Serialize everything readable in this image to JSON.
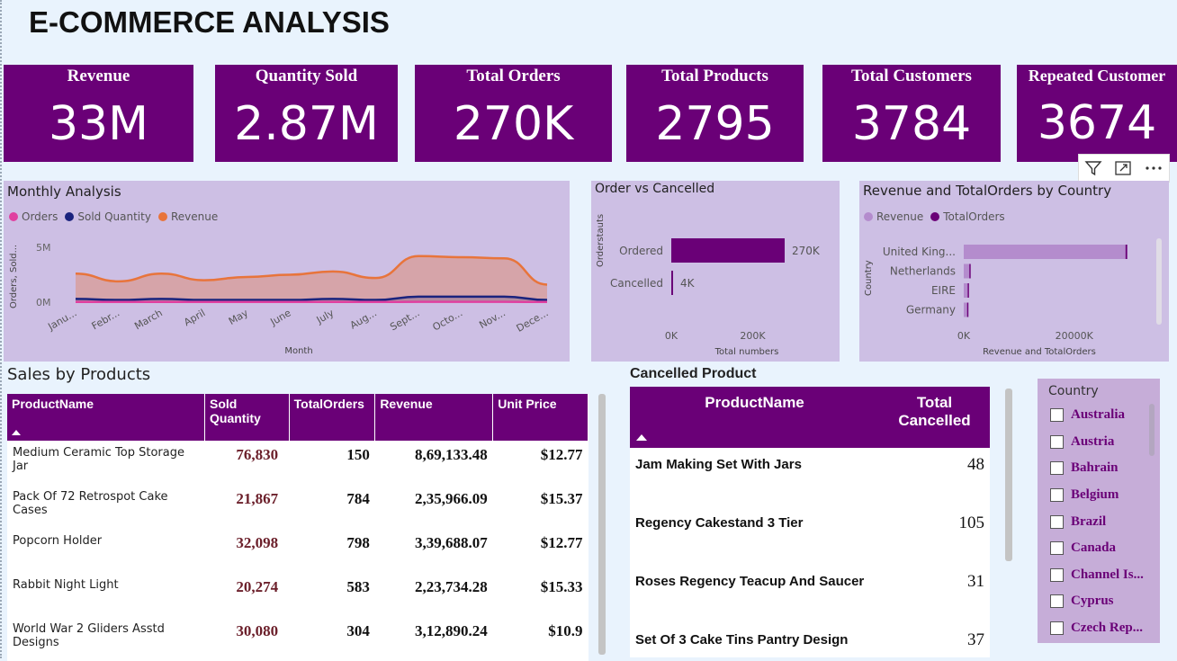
{
  "header": {
    "title": "E-COMMERCE ANALYSIS"
  },
  "kpis": [
    {
      "label": "Revenue",
      "value": "33M"
    },
    {
      "label": "Quantity Sold",
      "value": "2.87M"
    },
    {
      "label": "Total Orders",
      "value": "270K"
    },
    {
      "label": "Total Products",
      "value": "2795"
    },
    {
      "label": "Total Customers",
      "value": "3784"
    },
    {
      "label": "Repeated Customer",
      "value": "3674"
    }
  ],
  "colors": {
    "brand": "#6a0077",
    "orders": "#e040a0",
    "sold": "#1a237e",
    "revenue": "#e8743b",
    "bar_light": "#b48ccd"
  },
  "monthly": {
    "title": "Monthly Analysis",
    "legend": [
      "Orders",
      "Sold Quantity",
      "Revenue"
    ],
    "ylabel": "Orders, Sold...",
    "xlabel": "Month",
    "ticks": [
      "5M",
      "0M"
    ],
    "months": [
      "Janu...",
      "Febr...",
      "March",
      "April",
      "May",
      "June",
      "July",
      "Aug...",
      "Sept...",
      "Octo...",
      "Nov...",
      "Dece..."
    ]
  },
  "ordvscan": {
    "title": "Order vs Cancelled",
    "ylabel": "Orderstauts",
    "xlabel": "Total numbers",
    "cats": [
      "Ordered",
      "Cancelled"
    ],
    "labels": [
      "270K",
      "4K"
    ],
    "ticks": [
      "0K",
      "200K"
    ]
  },
  "country_chart": {
    "title": "Revenue and TotalOrders by Country",
    "legend": [
      "Revenue",
      "TotalOrders"
    ],
    "ylabel": "Country",
    "xlabel": "Revenue and TotalOrders",
    "cats": [
      "United King...",
      "Netherlands",
      "EIRE",
      "Germany"
    ],
    "ticks": [
      "0K",
      "20000K"
    ]
  },
  "sales": {
    "title": "Sales by Products",
    "cols": [
      "ProductName",
      "Sold Quantity",
      "TotalOrders",
      "Revenue",
      "Unit Price"
    ],
    "rows": [
      [
        "Medium Ceramic Top Storage Jar",
        "76,830",
        "150",
        "8,69,133.48",
        "$12.77"
      ],
      [
        "Pack Of 72 Retrospot Cake Cases",
        "21,867",
        "784",
        "2,35,966.09",
        "$15.37"
      ],
      [
        "Popcorn Holder",
        "32,098",
        "798",
        "3,39,688.07",
        "$12.77"
      ],
      [
        "Rabbit Night Light",
        "20,274",
        "583",
        "2,23,734.28",
        "$15.33"
      ],
      [
        "World War 2 Gliders Asstd Designs",
        "30,080",
        "304",
        "3,12,890.24",
        "$10.9"
      ]
    ]
  },
  "cancelled": {
    "title": "Cancelled Product",
    "cols": [
      "ProductName",
      "Total Cancelled"
    ],
    "rows": [
      [
        "Jam Making Set With Jars",
        "48"
      ],
      [
        "Regency Cakestand 3 Tier",
        "105"
      ],
      [
        "Roses Regency Teacup And Saucer",
        "31"
      ],
      [
        "Set Of 3 Cake Tins Pantry Design",
        "37"
      ]
    ]
  },
  "slicer": {
    "title": "Country",
    "items": [
      "Australia",
      "Austria",
      "Bahrain",
      "Belgium",
      "Brazil",
      "Canada",
      "Channel Is...",
      "Cyprus",
      "Czech Rep..."
    ]
  },
  "chart_data": [
    {
      "type": "area",
      "title": "Monthly Analysis",
      "xlabel": "Month",
      "ylabel": "Orders, Sold...",
      "categories": [
        "January",
        "February",
        "March",
        "April",
        "May",
        "June",
        "July",
        "August",
        "September",
        "October",
        "November",
        "December"
      ],
      "ylim": [
        0,
        6
      ],
      "series": [
        {
          "name": "Revenue",
          "values": [
            2.6,
            1.9,
            2.6,
            2.0,
            2.3,
            2.5,
            2.8,
            2.2,
            4.2,
            4.1,
            4.0,
            1.6
          ]
        },
        {
          "name": "Sold Quantity",
          "values": [
            0.3,
            0.2,
            0.3,
            0.2,
            0.2,
            0.2,
            0.3,
            0.2,
            0.5,
            0.5,
            0.5,
            0.2
          ]
        },
        {
          "name": "Orders",
          "values": [
            0.02,
            0.02,
            0.02,
            0.02,
            0.02,
            0.02,
            0.02,
            0.02,
            0.03,
            0.03,
            0.03,
            0.02
          ]
        }
      ]
    },
    {
      "type": "bar",
      "title": "Order vs Cancelled",
      "categories": [
        "Ordered",
        "Cancelled"
      ],
      "values": [
        270,
        4
      ],
      "xlabel": "Total numbers",
      "ylabel": "Orderstauts",
      "xlim": [
        0,
        300
      ]
    },
    {
      "type": "bar",
      "title": "Revenue and TotalOrders by Country",
      "categories": [
        "United King...",
        "Netherlands",
        "EIRE",
        "Germany"
      ],
      "series": [
        {
          "name": "Revenue",
          "values": [
            29000,
            1000,
            700,
            600
          ]
        },
        {
          "name": "TotalOrders",
          "values": [
            240,
            2,
            5,
            9
          ]
        }
      ],
      "xlabel": "Revenue and TotalOrders",
      "ylabel": "Country"
    }
  ]
}
